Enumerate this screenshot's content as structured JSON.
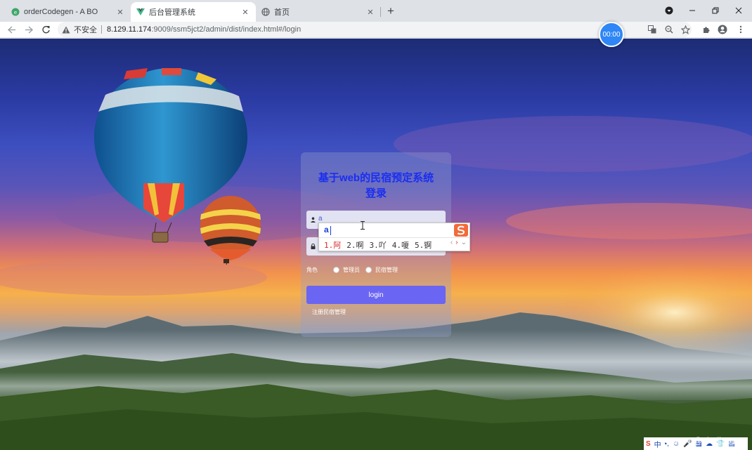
{
  "browser": {
    "tabs": [
      {
        "title": "orderCodegen - A BO",
        "close": "✕"
      },
      {
        "title": "后台管理系统",
        "close": "✕"
      },
      {
        "title": "首页",
        "close": "✕"
      }
    ],
    "new_tab": "+",
    "address": {
      "security_label": "不安全",
      "host": "8.129.11.174",
      "path": ":9009/ssm5jct2/admin/dist/index.html#/login"
    },
    "timer": "00:00",
    "icons": [
      "back-icon",
      "forward-icon",
      "reload-icon",
      "translate-icon",
      "zoom-icon",
      "star-icon",
      "extensions-icon",
      "profile-icon",
      "menu-icon"
    ]
  },
  "login": {
    "title_line1": "基于web的民宿预定系统",
    "title_line2": "登录",
    "username_value": "a",
    "password_value": "",
    "role_label": "角色",
    "roles": [
      "管理员",
      "民宿管理"
    ],
    "login_button": "login",
    "register_link": "注册民宿管理"
  },
  "ime": {
    "composition": "a",
    "candidates": [
      "1.阿",
      "2.啊",
      "3.吖",
      "4.嗄",
      "5.锕"
    ],
    "prev": "‹",
    "next": "›",
    "expand": "⌄"
  },
  "footer": {
    "watermark": "CSDN @shejj1011",
    "tray_items": [
      "S",
      "中",
      "•,",
      "☺",
      "🎤",
      "▦",
      "☁",
      "👕",
      "▤"
    ]
  },
  "colors": {
    "title": "#1a2ef0",
    "login_button": "#6a65f2",
    "timer": "#2f86f6"
  }
}
